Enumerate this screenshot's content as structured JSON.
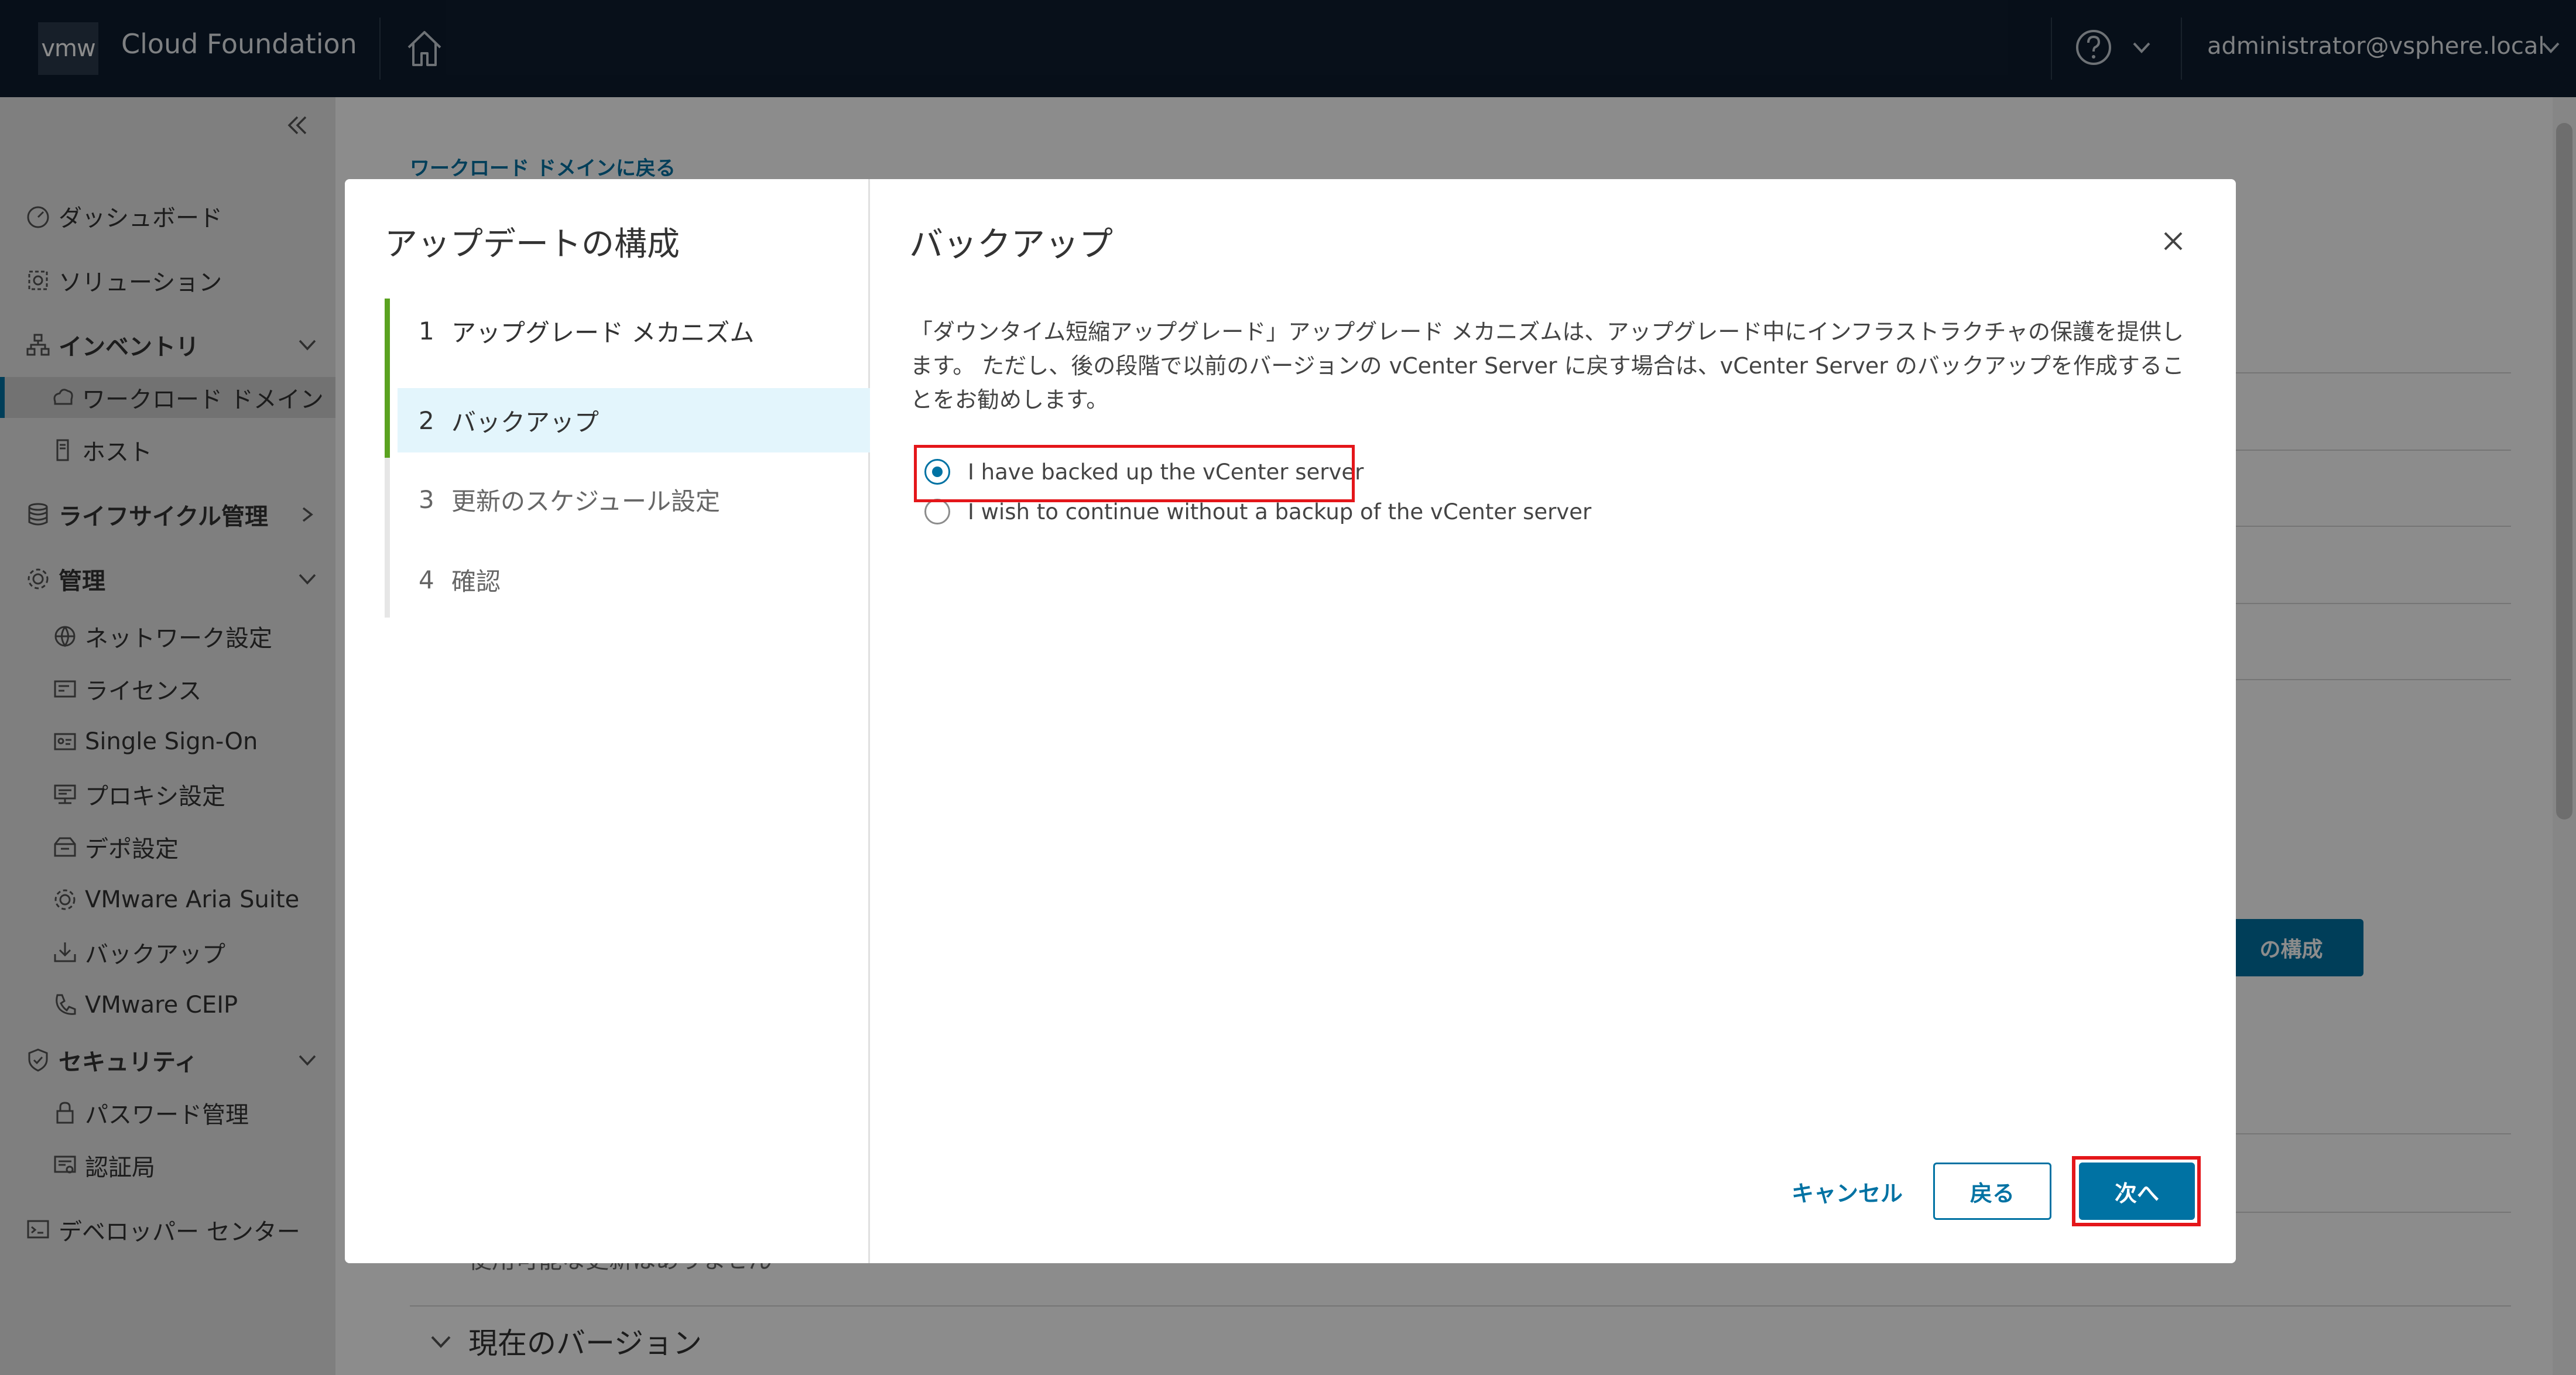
{
  "header": {
    "logo": "vmw",
    "app_title": "Cloud Foundation",
    "user": "administrator@vsphere.local"
  },
  "sidebar": {
    "dashboard": "ダッシュボード",
    "solutions": "ソリューション",
    "inventory": "インベントリ",
    "workload_domains": "ワークロード ドメイン",
    "hosts": "ホスト",
    "lifecycle": "ライフサイクル管理",
    "admin": "管理",
    "network_settings": "ネットワーク設定",
    "licensing": "ライセンス",
    "sso": "Single Sign-On",
    "proxy": "プロキシ設定",
    "depot": "デポ設定",
    "aria": "VMware Aria Suite",
    "backup": "バックアップ",
    "ceip": "VMware CEIP",
    "security": "セキュリティ",
    "password_mgmt": "パスワード管理",
    "cert_authority": "認証局",
    "developer_center": "デベロッパー センター"
  },
  "background": {
    "back_link": "ワークロード ドメインに戻る",
    "configure_button": "の構成",
    "subtext": "使用可能な更新はありません",
    "current_version": "現在のバージョン"
  },
  "wizard": {
    "title": "アップデートの構成",
    "steps": [
      {
        "num": "1",
        "label": "アップグレード メカニズム"
      },
      {
        "num": "2",
        "label": "バックアップ"
      },
      {
        "num": "3",
        "label": "更新のスケジュール設定"
      },
      {
        "num": "4",
        "label": "確認"
      }
    ]
  },
  "page": {
    "title": "バックアップ",
    "description": "「ダウンタイム短縮アップグレード」アップグレード メカニズムは、アップグレード中にインフラストラクチャの保護を提供します。 ただし、後の段階で以前のバージョンの vCenter Server に戻す場合は、vCenter Server のバックアップを作成することをお勧めします。",
    "option_backed_up": "I have backed up the vCenter server",
    "option_no_backup": "I wish to continue without a backup of the vCenter server",
    "selected": "backed_up"
  },
  "footer": {
    "cancel": "キャンセル",
    "back": "戻る",
    "next": "次へ"
  },
  "colors": {
    "header_bg": "#0e1d2f",
    "accent": "#0072a3",
    "progress": "#5aa220",
    "highlight": "#e4161a"
  }
}
